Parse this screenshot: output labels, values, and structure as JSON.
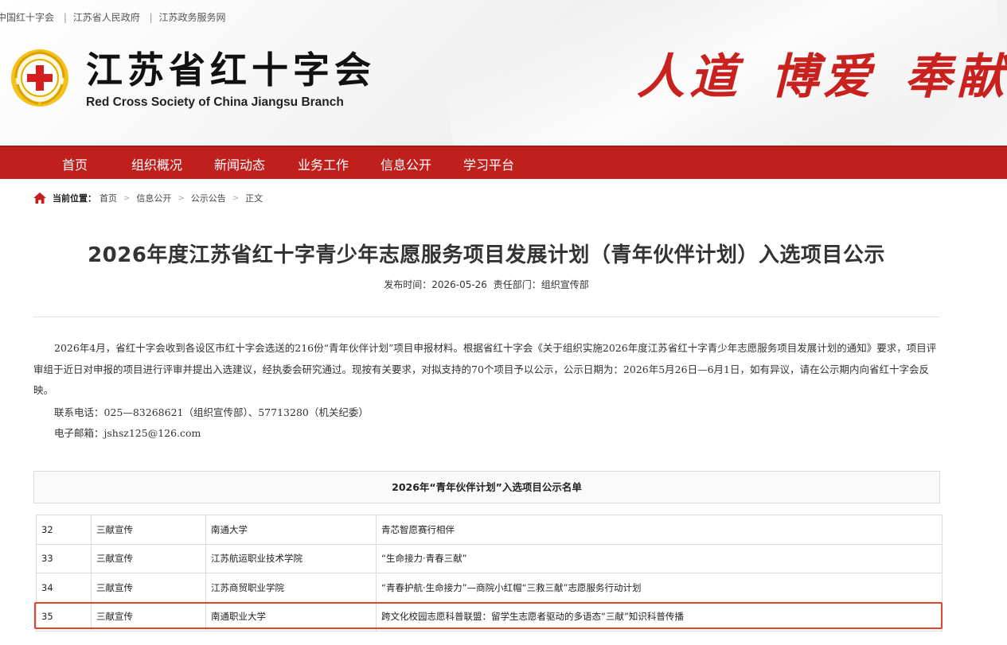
{
  "top_links": [
    "中国红十字会",
    "江苏省人民政府",
    "江苏政务服务网"
  ],
  "site": {
    "title": "江苏省红十字会",
    "subtitle": "Red Cross Society of China Jiangsu Branch",
    "slogan": [
      "人道",
      "博爱",
      "奉献"
    ]
  },
  "nav": [
    "首页",
    "组织概况",
    "新闻动态",
    "业务工作",
    "信息公开",
    "学习平台"
  ],
  "breadcrumb": {
    "label": "当前位置：",
    "items": [
      "首页",
      "信息公开",
      "公示公告",
      "正文"
    ]
  },
  "article": {
    "title": "2026年度江苏省红十字青少年志愿服务项目发展计划（青年伙伴计划）入选项目公示",
    "published": "发布时间：2026-05-26",
    "department": "责任部门：组织宣传部",
    "paragraph": "2026年4月，省红十字会收到各设区市红十字会选送的216份“青年伙伴计划”项目申报材料。根据省红十字会《关于组织实施2026年度江苏省红十字青少年志愿服务项目发展计划的通知》要求，项目评审组于近日对申报的项目进行评审并提出入选建议，经执委会研究通过。现按有关要求，对拟支持的70个项目予以公示，公示日期为：2026年5月26日—6月1日，如有异议，请在公示期内向省红十字会反映。",
    "phone": "联系电话：025—83268621（组织宣传部）、57713280（机关纪委）",
    "email": "电子邮箱：jshsz125@126.com"
  },
  "table": {
    "caption": "2026年“青年伙伴计划”入选项目公示名单",
    "rows": [
      [
        "32",
        "三献宣传",
        "南通大学",
        "青芯智愿赛行相伴"
      ],
      [
        "33",
        "三献宣传",
        "江苏航运职业技术学院",
        "“生命接力·青春三献”"
      ],
      [
        "34",
        "三献宣传",
        "江苏商贸职业学院",
        "“青春护航·生命接力”—商院小红帽“三救三献”志愿服务行动计划"
      ],
      [
        "35",
        "三献宣传",
        "南通职业大学",
        "跨文化校园志愿科普联盟：留学生志愿者驱动的多语态“三献”知识科普传播"
      ]
    ],
    "highlighted_row": "35"
  },
  "colors": {
    "brand_red": "#c0201d",
    "highlight": "#e0472a"
  }
}
